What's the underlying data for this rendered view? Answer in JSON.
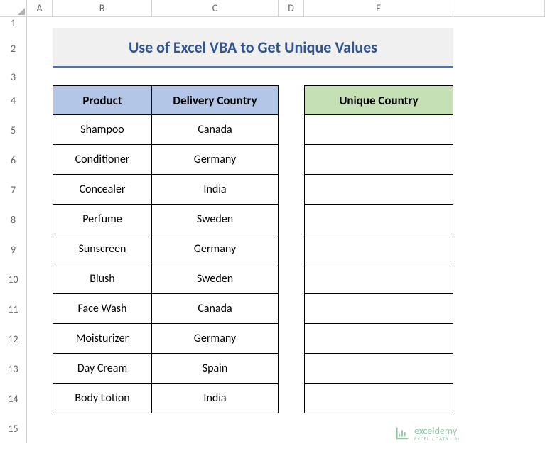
{
  "columns": [
    "A",
    "B",
    "C",
    "D",
    "E"
  ],
  "rows": [
    "1",
    "2",
    "3",
    "4",
    "5",
    "6",
    "7",
    "8",
    "9",
    "10",
    "11",
    "12",
    "13",
    "14",
    "15"
  ],
  "title": "Use of Excel VBA to Get Unique Values",
  "headers": {
    "product": "Product",
    "delivery": "Delivery Country",
    "unique": "Unique Country"
  },
  "data": [
    {
      "product": "Shampoo",
      "country": "Canada"
    },
    {
      "product": "Conditioner",
      "country": "Germany"
    },
    {
      "product": "Concealer",
      "country": "India"
    },
    {
      "product": "Perfume",
      "country": "Sweden"
    },
    {
      "product": "Sunscreen",
      "country": "Germany"
    },
    {
      "product": "Blush",
      "country": "Sweden"
    },
    {
      "product": "Face Wash",
      "country": "Canada"
    },
    {
      "product": "Moisturizer",
      "country": "Germany"
    },
    {
      "product": "Day Cream",
      "country": "Spain"
    },
    {
      "product": "Body Lotion",
      "country": "India"
    }
  ],
  "unique": [
    "",
    "",
    "",
    "",
    "",
    "",
    "",
    "",
    "",
    ""
  ],
  "watermark": {
    "name": "exceldemy",
    "sub": "EXCEL · DATA · BI"
  }
}
